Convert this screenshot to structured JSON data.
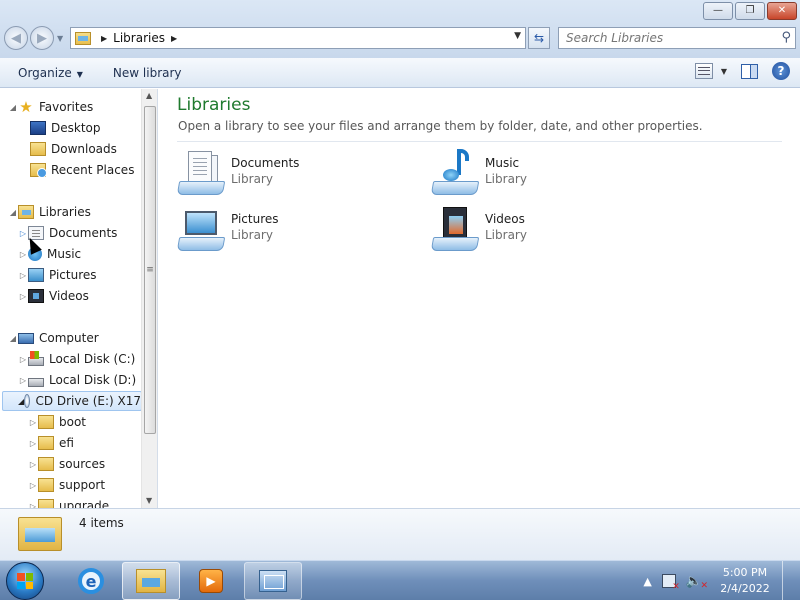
{
  "window": {
    "minimize_glyph": "—",
    "maximize_glyph": "❐",
    "close_glyph": "✕"
  },
  "nav": {
    "back_glyph": "◀",
    "forward_glyph": "▶",
    "history_glyph": "▼"
  },
  "address_bar": {
    "crumb": "Libraries",
    "arrow": "▶",
    "dropdown_glyph": "▼",
    "refresh_glyph": "⇆"
  },
  "search": {
    "placeholder": "Search Libraries",
    "icon": "search-icon",
    "glyph": "⚲"
  },
  "command_bar": {
    "organize_label": "Organize",
    "organize_caret": "▼",
    "new_library_label": "New library",
    "view_caret": "▼",
    "help_glyph": "?"
  },
  "nav_pane": {
    "favorites": {
      "label": "Favorites",
      "expander": "◢",
      "icon": "star-icon",
      "icon_glyph": "★"
    },
    "favorites_items": [
      {
        "label": "Desktop",
        "icon": "desktop-icon"
      },
      {
        "label": "Downloads",
        "icon": "downloads-folder-icon"
      },
      {
        "label": "Recent Places",
        "icon": "recent-places-icon"
      }
    ],
    "libraries": {
      "label": "Libraries",
      "expander": "◢",
      "icon": "libraries-icon"
    },
    "libraries_items": [
      {
        "label": "Documents",
        "expander": "▷",
        "icon": "documents-icon"
      },
      {
        "label": "Music",
        "expander": "▷",
        "icon": "music-icon"
      },
      {
        "label": "Pictures",
        "expander": "▷",
        "icon": "pictures-icon"
      },
      {
        "label": "Videos",
        "expander": "▷",
        "icon": "videos-icon"
      }
    ],
    "computer": {
      "label": "Computer",
      "expander": "◢",
      "icon": "computer-icon"
    },
    "computer_items": [
      {
        "label": "Local Disk (C:)",
        "expander": "▷",
        "icon": "local-disk-c-icon"
      },
      {
        "label": "Local Disk (D:)",
        "expander": "▷",
        "icon": "local-disk-d-icon"
      },
      {
        "label": "CD Drive (E:) X17",
        "expander": "◢",
        "icon": "cd-drive-icon"
      }
    ],
    "cd_items": [
      {
        "label": "boot",
        "expander": "▷"
      },
      {
        "label": "efi",
        "expander": "▷"
      },
      {
        "label": "sources",
        "expander": "▷"
      },
      {
        "label": "support",
        "expander": "▷"
      },
      {
        "label": "upgrade",
        "expander": "▷"
      }
    ],
    "scroll_up": "▲",
    "scroll_down": "▼",
    "scroll_grip": "≡"
  },
  "main": {
    "title": "Libraries",
    "description": "Open a library to see your files and arrange them by folder, date, and other properties.",
    "libraries": [
      {
        "name": "Documents",
        "type": "Library",
        "icon": "documents-library-icon"
      },
      {
        "name": "Music",
        "type": "Library",
        "icon": "music-library-icon"
      },
      {
        "name": "Pictures",
        "type": "Library",
        "icon": "pictures-library-icon"
      },
      {
        "name": "Videos",
        "type": "Library",
        "icon": "videos-library-icon"
      }
    ]
  },
  "details": {
    "items_count": "4 items"
  },
  "taskbar": {
    "ie_glyph": "e",
    "wmp_glyph": "▶",
    "time": "5:00 PM",
    "date": "2/4/2022",
    "tray_arrow": "▲",
    "volume_glyph": "🔈",
    "volume_x": "✕"
  }
}
